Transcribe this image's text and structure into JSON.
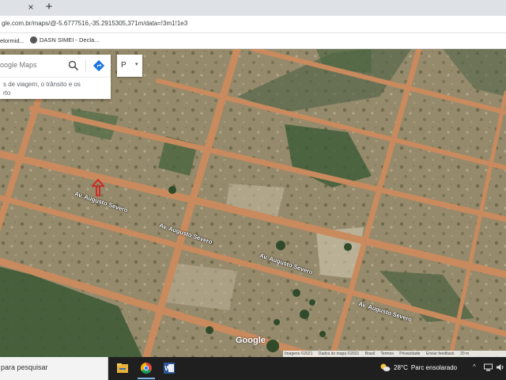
{
  "browser": {
    "tab_close_glyph": "×",
    "new_tab_glyph": "+",
    "url": "gle.com.br/maps/@-5.6777516,-35.2915305,371m/data=!3m1!1e3",
    "bookmarks": [
      {
        "label": "elormid..."
      },
      {
        "label": "DASN SIMEI - Decla..."
      }
    ]
  },
  "maps": {
    "search_placeholder": "oogle Maps",
    "suggestion_text": "s de viagem, o trânsito e os\nrto",
    "layer_button_label": "P  ",
    "layer_button_caret": "▾",
    "road_labels": [
      {
        "text": "Av. Augusto Severo"
      },
      {
        "text": "Av. Augusto Severo"
      },
      {
        "text": "Av. Augusto Severo"
      },
      {
        "text": "Av. Augusto Severo"
      }
    ],
    "google_logo": "Google",
    "attribution": [
      "Imagens ©2021",
      "Dados do mapa ©2021",
      "Brasil",
      "Termos",
      "Privacidade",
      "Enviar feedback"
    ],
    "scale": "20 m"
  },
  "taskbar": {
    "search_text": "para pesquisar",
    "weather_temp": "28°C",
    "weather_text": "Parc ensolarado",
    "tray_chevron": "^",
    "accent": "#7fb4e8"
  }
}
